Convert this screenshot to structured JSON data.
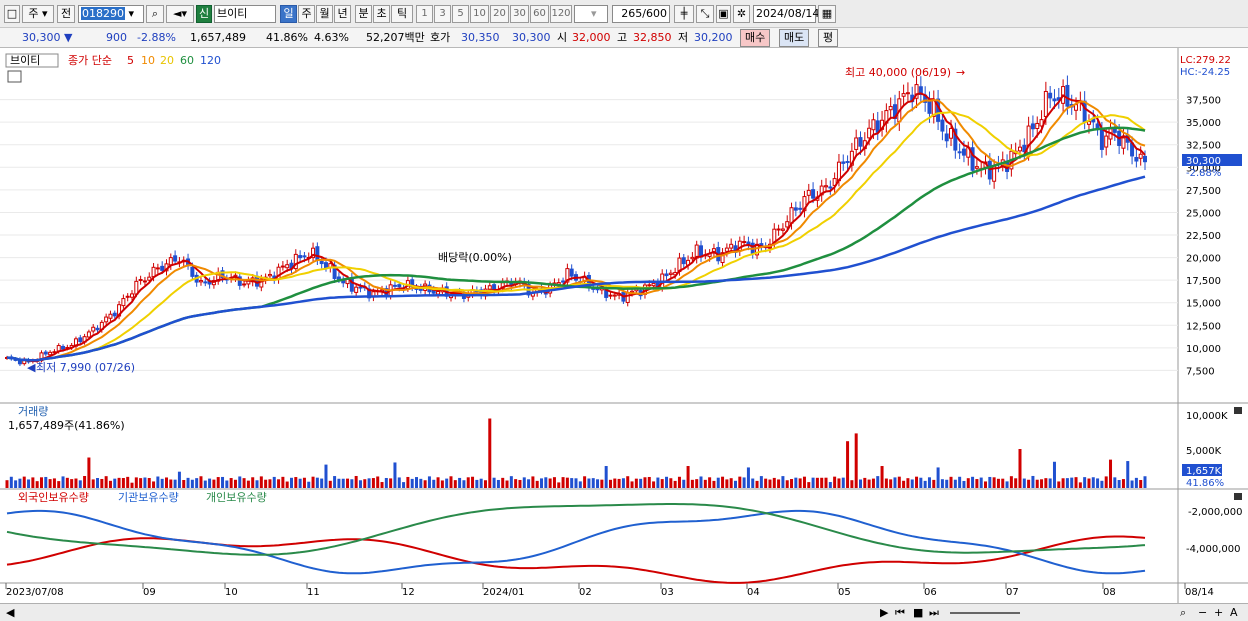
{
  "toolbar": {
    "period_left": "주",
    "prev_label": "전",
    "stock_code": "018290",
    "credit_badge": "신",
    "stock_name": "브이티",
    "periods": [
      "일",
      "주",
      "월",
      "년",
      "분",
      "초",
      "틱"
    ],
    "intervals": [
      "1",
      "3",
      "5",
      "10",
      "20",
      "30",
      "60",
      "120"
    ],
    "count": "265",
    "count_total": "/600",
    "date": "2024/08/14"
  },
  "quote": {
    "price": "30,300",
    "arrow": "▼",
    "change": "900",
    "change_pct": "-2.88%",
    "volume": "1,657,489",
    "volume_ratio": "41.86%",
    "turnover": "4.63%",
    "amount": "52,207백만",
    "bid_label": "호가",
    "ask": "30,350",
    "bid": "30,300",
    "open_label": "시",
    "open": "32,000",
    "high_label": "고",
    "high": "32,850",
    "low_label": "저",
    "low": "30,200",
    "buy_label": "매수",
    "sell_label": "매도",
    "eval_label": "평"
  },
  "chart_data": {
    "type": "line",
    "legend": {
      "name": "브이티",
      "ma_label": "종가 단순",
      "ma": [
        "5",
        "10",
        "20",
        "60",
        "120"
      ],
      "ma_colors": [
        "#d00000",
        "#f08a00",
        "#f0d000",
        "#1f8f3f",
        "#2050d0"
      ]
    },
    "x_labels": [
      "2023/07/08",
      "09",
      "10",
      "11",
      "12",
      "2024/01",
      "02",
      "03",
      "04",
      "05",
      "06",
      "07",
      "08",
      "08/14"
    ],
    "y_ticks": [
      "37,500",
      "35,000",
      "32,500",
      "30,000",
      "27,500",
      "25,000",
      "22,500",
      "20,000",
      "17,500",
      "15,000",
      "12,500",
      "10,000",
      "7,500"
    ],
    "ylim": [
      5000,
      41000
    ],
    "lc": "LC:279.22",
    "hc": "HC:-24.25",
    "current_price": "30,300",
    "current_change": "-2.88%",
    "annot_high": "최고 40,000 (06/19)",
    "annot_low": "최저 7,990 (07/26)",
    "annot_div": "배당락(0.00%)",
    "price_anchors": [
      [
        0,
        8800
      ],
      [
        5,
        8400
      ],
      [
        10,
        9600
      ],
      [
        15,
        10300
      ],
      [
        20,
        12000
      ],
      [
        25,
        14000
      ],
      [
        30,
        17000
      ],
      [
        35,
        18800
      ],
      [
        40,
        20000
      ],
      [
        45,
        17000
      ],
      [
        50,
        18000
      ],
      [
        55,
        17200
      ],
      [
        60,
        17600
      ],
      [
        65,
        19200
      ],
      [
        70,
        20500
      ],
      [
        72,
        20000
      ],
      [
        78,
        17200
      ],
      [
        85,
        16000
      ],
      [
        92,
        17000
      ],
      [
        98,
        16400
      ],
      [
        105,
        15800
      ],
      [
        112,
        16500
      ],
      [
        118,
        17400
      ],
      [
        122,
        16000
      ],
      [
        126,
        16600
      ],
      [
        130,
        18200
      ],
      [
        134,
        17300
      ],
      [
        138,
        16200
      ],
      [
        142,
        15600
      ],
      [
        148,
        16600
      ],
      [
        152,
        17600
      ],
      [
        156,
        19200
      ],
      [
        160,
        20600
      ],
      [
        165,
        20300
      ],
      [
        170,
        21600
      ],
      [
        175,
        20900
      ],
      [
        180,
        23600
      ],
      [
        185,
        26600
      ],
      [
        190,
        27600
      ],
      [
        195,
        31200
      ],
      [
        200,
        34000
      ],
      [
        205,
        36200
      ],
      [
        210,
        38600
      ],
      [
        214,
        37000
      ],
      [
        218,
        33500
      ],
      [
        222,
        31500
      ],
      [
        226,
        29700
      ],
      [
        230,
        30000
      ],
      [
        234,
        31500
      ],
      [
        238,
        34200
      ],
      [
        242,
        38000
      ],
      [
        246,
        37500
      ],
      [
        250,
        36000
      ],
      [
        254,
        33000
      ],
      [
        257,
        33900
      ],
      [
        260,
        32200
      ],
      [
        264,
        30300
      ]
    ],
    "volume_panel": {
      "title": "거래량",
      "readout": "1,657,489주(41.86%)",
      "ticks": [
        "10,000K",
        "5,000K"
      ],
      "current": "1,657K",
      "current_pct": "41.86%",
      "ylim": [
        0,
        11000
      ],
      "spikes": [
        [
          19,
          4300
        ],
        [
          40,
          2300
        ],
        [
          74,
          3300
        ],
        [
          90,
          3600
        ],
        [
          112,
          9800
        ],
        [
          139,
          3100
        ],
        [
          158,
          3100
        ],
        [
          172,
          2900
        ],
        [
          195,
          6600
        ],
        [
          197,
          7700
        ],
        [
          203,
          3100
        ],
        [
          216,
          2900
        ],
        [
          235,
          5500
        ],
        [
          243,
          3700
        ],
        [
          256,
          4000
        ],
        [
          260,
          3800
        ],
        [
          264,
          1657
        ]
      ]
    },
    "holding_panel": {
      "series": [
        {
          "name": "외국인보유수량",
          "color": "#d00000"
        },
        {
          "name": "기관보유수량",
          "color": "#2060d0"
        },
        {
          "name": "개인보유수량",
          "color": "#2a8a4a"
        }
      ],
      "ticks": [
        "-2,000,000",
        "-4,000,000"
      ],
      "ylim": [
        -5200000,
        -1000000
      ]
    }
  },
  "status": {
    "icons": [
      "scroll-left-icon",
      "scroll-right-icon",
      "first-page-icon",
      "stop-icon",
      "last-page-icon",
      "zoom-out-icon",
      "zoom-in-icon",
      "font-icon"
    ]
  }
}
